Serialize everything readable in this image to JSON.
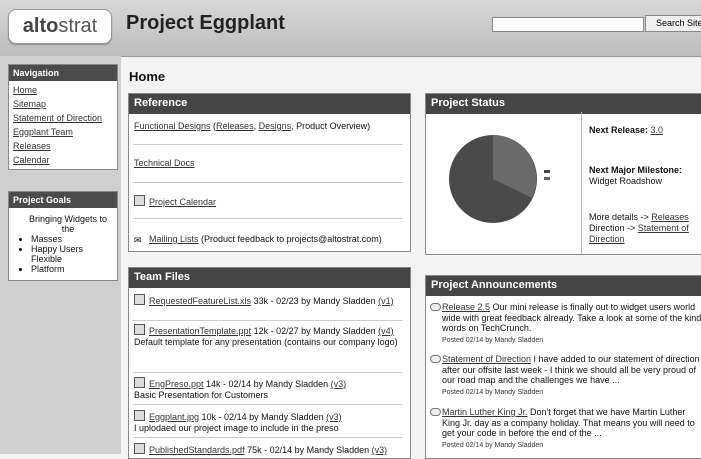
{
  "header": {
    "logo_a": "alto",
    "logo_b": "strat",
    "project_title": "Project Eggplant",
    "search_placeholder": "",
    "search_button": "Search Site"
  },
  "sidebar": {
    "nav_title": "Navigation",
    "nav_items": [
      "Home",
      "Sitemap",
      "Statement of Direction",
      "Eggplant Team",
      "Releases",
      "Calendar"
    ],
    "goals_title": "Project Goals",
    "goals": [
      "Bringing Widgets to the",
      "Masses",
      "Happy Users",
      "Flexible",
      "Platform"
    ]
  },
  "page_title": "Home",
  "reference": {
    "title": "Reference",
    "row1_link": "Functional Designs",
    "row1_open": " (",
    "row1_releases": "Releases",
    "row1_comma": ", ",
    "row1_designs": "Designs",
    "row1_rest": ", Product Overview)",
    "tech_docs": "Technical Docs",
    "calendar": "Project Calendar",
    "mailing": "Mailing Lists",
    "mailing_rest": " (Product feedback to projects@altostrat.com)"
  },
  "team_files": {
    "title": "Team Files",
    "files": [
      {
        "name": "RequestedFeatureList.xls",
        "meta": " 33k - 02/23 by Mandy Sladden ",
        "ver": "(v1)",
        "desc": ""
      },
      {
        "name": "PresentationTemplate.ppt",
        "meta": " 12k - 02/27 by Mandy Sladden ",
        "ver": "(v4)",
        "desc": "Default template for any presentation (contains our company logo)"
      },
      {
        "name": "EngPreso.ppt",
        "meta": " 14k - 02/14 by Mandy Sladden ",
        "ver": "(v3)",
        "desc": "Basic Presentation for Customers"
      },
      {
        "name": "Eggplant.jpg",
        "meta": " 10k - 02/14 by Mandy Sladden ",
        "ver": "(v3)",
        "desc": "I uplodaed our project image to include in the preso"
      },
      {
        "name": "PublishedStandards.pdf",
        "meta": " 75k - 02/14 by Mandy Sladden ",
        "ver": "(v3)",
        "desc": ""
      }
    ]
  },
  "status": {
    "title": "Project Status",
    "next_release_label": "Next Release: ",
    "next_release_value": "3.0",
    "milestone_label": "Next Major Milestone:",
    "milestone_value": "Widget Roadshow",
    "details_prefix": "More details -> ",
    "details_link": "Releases",
    "direction_prefix": "Direction -> ",
    "direction_link": "Statement of Direction",
    "pie_colors": [
      "#4a4a4a",
      "#6a6a6a"
    ]
  },
  "announcements": {
    "title": "Project Announcements",
    "items": [
      {
        "link": "Release 2.5",
        "text": " Our mini release is finally out to widget users world wide with great feedback already. Take a look at some of the kind words on TechCrunch.",
        "posted": "Posted 02/14 by Mandy Sladden"
      },
      {
        "link": "Statement of Direction",
        "text": " I have added to our statement of direction after our offsite last week - I think we should all be very proud of our road map and the challenges we have ...",
        "posted": "Posted 02/14 by Mandy Sladden"
      },
      {
        "link": "Martin Luther King Jr.",
        "text": " Don't forget that we have Martin Luther King Jr. day as a company holiday. That means you will need to get your code in before the end of the ...",
        "posted": "Posted 02/14 by Mandy Sladden"
      }
    ]
  }
}
